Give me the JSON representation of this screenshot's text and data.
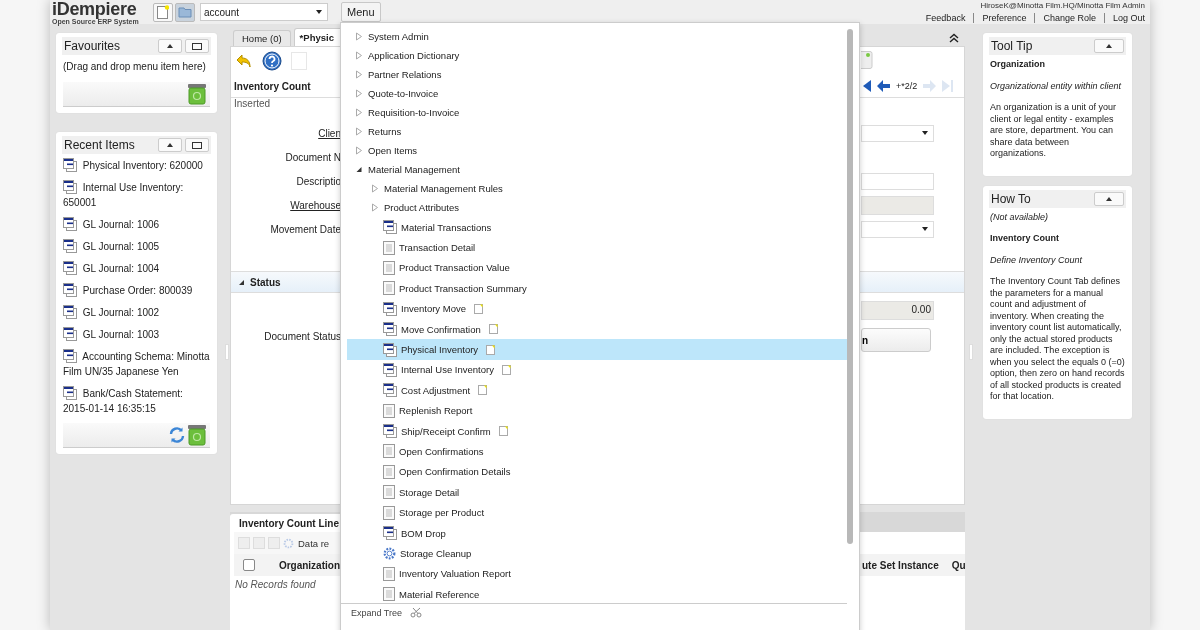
{
  "header": {
    "logo": "iDempiere",
    "tagline": "Open Source ERP System",
    "search": {
      "value": "account"
    },
    "menu_button": "Menu",
    "user": "HiroseK@Minotta Film.HQ/Minotta Film Admin",
    "links": [
      "Feedback",
      "Preference",
      "Change Role",
      "Log Out"
    ]
  },
  "favourites": {
    "title": "Favourites",
    "hint": "(Drag and drop menu item here)"
  },
  "recent_items": {
    "title": "Recent Items",
    "items": [
      "Physical Inventory: 620000",
      "Internal Use Inventory: 650001",
      "GL Journal: 1006",
      "GL Journal: 1005",
      "GL Journal: 1004",
      "Purchase Order: 800039",
      "GL Journal: 1002",
      "GL Journal: 1003",
      "Accounting Schema: Minotta Film UN/35 Japanese Yen",
      "Bank/Cash Statement: 2015-01-14 16:35:15"
    ]
  },
  "window": {
    "tabs": [
      {
        "label": "Home (0)",
        "selected": false
      },
      {
        "label": "*Physic",
        "selected": true
      }
    ],
    "tab_title": "Inventory Count",
    "record_status": "Inserted",
    "navigation": "+*2/2",
    "fields": [
      {
        "label": "Clien",
        "link": true,
        "kind": "select"
      },
      {
        "label": "Document N",
        "link": false,
        "kind": "none"
      },
      {
        "label": "Descriptio",
        "link": false,
        "kind": "text"
      },
      {
        "label": "Warehouse",
        "link": true,
        "kind": "readonly"
      },
      {
        "label": "Movement Date",
        "link": false,
        "kind": "select"
      }
    ],
    "status_section": "Status",
    "status_label": "Document Status",
    "amount": "0.00",
    "action_button": "n",
    "lines": {
      "tab": "Inventory Count Line",
      "select_all_checked": false,
      "toolbar_text": "Data re",
      "columns": [
        "Organization",
        "ute Set Instance",
        "Qu"
      ],
      "empty_text": "No Records found"
    }
  },
  "menu": {
    "items": [
      {
        "label": "System Admin",
        "kind": "folder",
        "expanded": false,
        "selected": false
      },
      {
        "label": "Application Dictionary",
        "kind": "folder",
        "expanded": false,
        "selected": false
      },
      {
        "label": "Partner Relations",
        "kind": "folder",
        "expanded": false,
        "selected": false
      },
      {
        "label": "Quote-to-Invoice",
        "kind": "folder",
        "expanded": false,
        "selected": false
      },
      {
        "label": "Requisition-to-Invoice",
        "kind": "folder",
        "expanded": false,
        "selected": false
      },
      {
        "label": "Returns",
        "kind": "folder",
        "expanded": false,
        "selected": false
      },
      {
        "label": "Open Items",
        "kind": "folder",
        "expanded": false,
        "selected": false
      },
      {
        "label": "Material Management",
        "kind": "folder",
        "expanded": true,
        "selected": false,
        "children": [
          {
            "label": "Material Management Rules",
            "kind": "folder",
            "expanded": false,
            "selected": false
          },
          {
            "label": "Product Attributes",
            "kind": "folder",
            "expanded": false,
            "selected": false
          },
          {
            "label": "Material Transactions",
            "kind": "window",
            "quick_create": false,
            "selected": false
          },
          {
            "label": "Transaction Detail",
            "kind": "report",
            "quick_create": false,
            "selected": false
          },
          {
            "label": "Product Transaction Value",
            "kind": "report",
            "quick_create": false,
            "selected": false
          },
          {
            "label": "Product Transaction Summary",
            "kind": "report",
            "quick_create": false,
            "selected": false
          },
          {
            "label": "Inventory Move",
            "kind": "window",
            "quick_create": true,
            "selected": false
          },
          {
            "label": "Move Confirmation",
            "kind": "window",
            "quick_create": true,
            "selected": false
          },
          {
            "label": "Physical Inventory",
            "kind": "window",
            "quick_create": true,
            "selected": true
          },
          {
            "label": "Internal Use Inventory",
            "kind": "window",
            "quick_create": true,
            "selected": false
          },
          {
            "label": "Cost Adjustment",
            "kind": "window",
            "quick_create": true,
            "selected": false
          },
          {
            "label": "Replenish Report",
            "kind": "report",
            "quick_create": false,
            "selected": false
          },
          {
            "label": "Ship/Receipt Confirm",
            "kind": "window",
            "quick_create": true,
            "selected": false
          },
          {
            "label": "Open Confirmations",
            "kind": "report",
            "quick_create": false,
            "selected": false
          },
          {
            "label": "Open Confirmation Details",
            "kind": "report",
            "quick_create": false,
            "selected": false
          },
          {
            "label": "Storage Detail",
            "kind": "report",
            "quick_create": false,
            "selected": false
          },
          {
            "label": "Storage per Product",
            "kind": "report",
            "quick_create": false,
            "selected": false
          },
          {
            "label": "BOM Drop",
            "kind": "window",
            "quick_create": false,
            "selected": false
          },
          {
            "label": "Storage Cleanup",
            "kind": "process",
            "quick_create": false,
            "selected": false
          },
          {
            "label": "Inventory Valuation Report",
            "kind": "report",
            "quick_create": false,
            "selected": false
          },
          {
            "label": "Material Reference",
            "kind": "report",
            "quick_create": false,
            "selected": false
          }
        ]
      }
    ],
    "footer": "Expand Tree"
  },
  "tool_tip": {
    "title": "Tool Tip",
    "field_name": "Organization",
    "summary": "Organizational entity within client",
    "help": "An organization is a unit of your client or legal entity - examples are store, department. You can share data between organizations."
  },
  "how_to": {
    "title": "How To",
    "status": "(Not available)",
    "name": "Inventory Count",
    "summary": "Define Inventory Count",
    "help": "The Inventory Count Tab defines the parameters for a manual count and adjustment of inventory. When creating the inventory count list automatically, only the actual stored products are included. The exception is when you select the equals 0 (=0) option, then zero on hand records of all stocked products is created for that location."
  }
}
